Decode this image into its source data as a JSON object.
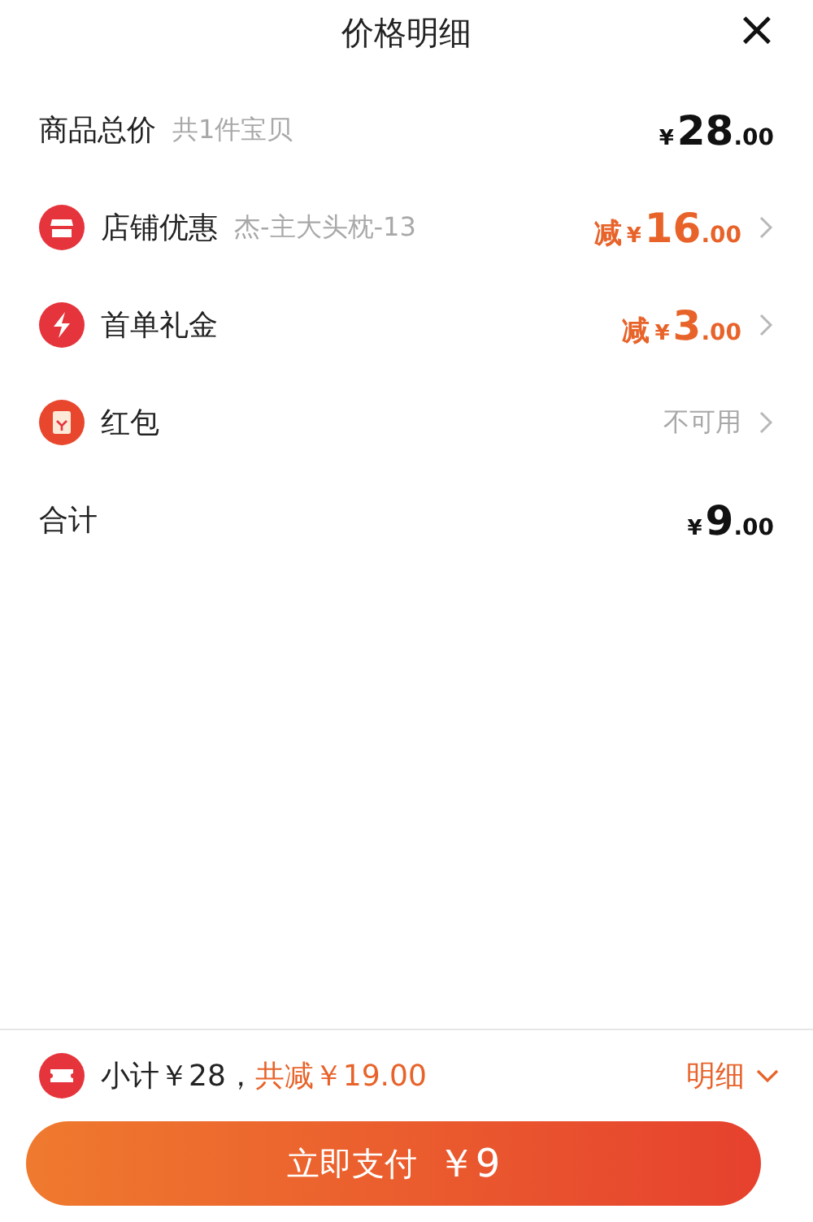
{
  "header": {
    "title": "价格明细",
    "close": "×"
  },
  "rows": [
    {
      "kind": "total",
      "label": "商品总价",
      "note": "共1件宝贝",
      "price": {
        "currency": "¥",
        "integer": "28",
        "decimals": ".00"
      },
      "arrow": false
    },
    {
      "kind": "store",
      "label": "店铺优惠",
      "note": "杰-主大头枕-13",
      "price": {
        "prefix": "减",
        "currency": "¥",
        "integer": "16",
        "decimals": ".00"
      },
      "arrow": true
    },
    {
      "kind": "coupon",
      "label": "首单礼金",
      "price": {
        "prefix": "减",
        "currency": "¥",
        "integer": "3",
        "decimals": ".00"
      },
      "arrow": true
    },
    {
      "kind": "envelope",
      "label": "红包",
      "status": "不可用",
      "arrow": true
    },
    {
      "kind": "sum",
      "label": "合计",
      "price": {
        "currency": "¥",
        "integer": "9",
        "decimals": ".00"
      },
      "arrow": false
    }
  ],
  "footer": {
    "subtotal": "小计￥28，",
    "reduction": "共减￥19.00",
    "details": "明细",
    "details_expanded": false,
    "pay_button": {
      "label": "立即支付",
      "amount": "￥9"
    }
  }
}
